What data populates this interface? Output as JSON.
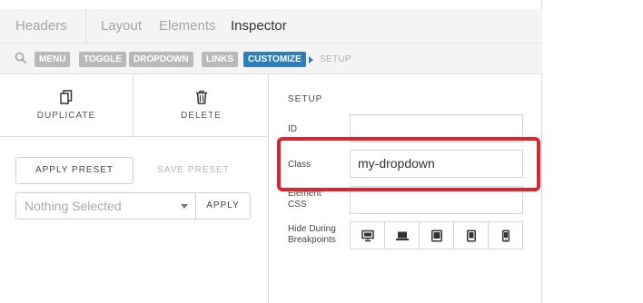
{
  "tabs": [
    "Headers",
    "Layout",
    "Elements",
    "Inspector"
  ],
  "active_tab": "Inspector",
  "breadcrumbs": [
    "MENU",
    "TOGGLE",
    "DROPDOWN",
    "LINKS",
    "CUSTOMIZE"
  ],
  "breadcrumb_current": "SETUP",
  "actions": {
    "duplicate_label": "DUPLICATE",
    "delete_label": "DELETE"
  },
  "presets": {
    "apply_preset_label": "APPLY PRESET",
    "save_preset_label": "SAVE PRESET",
    "select_value": "Nothing Selected",
    "apply_label": "APPLY"
  },
  "setup": {
    "title": "SETUP",
    "id_label": "ID",
    "id_value": "",
    "class_label": "Class",
    "class_value": "my-dropdown",
    "css_label": "Element CSS",
    "css_value": "",
    "breakpoints_label": "Hide During Breakpoints",
    "breakpoints": [
      "desktop-icon",
      "laptop-icon",
      "tablet-landscape-icon",
      "tablet-portrait-icon",
      "phone-icon"
    ]
  },
  "colors": {
    "accent": "#2e7fb8",
    "highlight": "#e0242d"
  }
}
